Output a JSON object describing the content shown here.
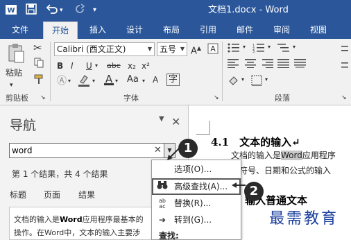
{
  "titlebar": {
    "title": "文档1.docx - Word",
    "quick_access": [
      "word-logo-icon",
      "save-icon",
      "undo-icon",
      "undo-dropdown-icon",
      "redo-icon",
      "customize-quick-access-icon"
    ]
  },
  "tabs": [
    "文件",
    "开始",
    "插入",
    "设计",
    "布局",
    "引用",
    "邮件",
    "审阅",
    "视图"
  ],
  "active_tab": "开始",
  "ribbon": {
    "clipboard": {
      "paste_label": "粘贴",
      "group_label": "剪贴板"
    },
    "font": {
      "font_name": "Calibri (西文正文)",
      "font_size": "五号",
      "buttons": [
        "B",
        "I",
        "U",
        "abc",
        "x₂",
        "x²"
      ],
      "group_label": "字体"
    },
    "paragraph": {
      "group_label": "段落"
    }
  },
  "nav_pane": {
    "title": "导航",
    "search_value": "word",
    "result_count": "第 1 个结果，共 4 个结果",
    "tabs": [
      "标题",
      "页面",
      "结果"
    ],
    "snippet_line1_prefix": "文档的输入是",
    "snippet_line1_bold": "Word",
    "snippet_line1_suffix": "应用程序最基本的",
    "snippet_line2": "操作。在Word中，文本的输入主要涉"
  },
  "menu": {
    "items": [
      {
        "label": "选项(O)...",
        "icon": ""
      },
      {
        "label": "高级查找(A)...",
        "icon": "binoculars-icon"
      },
      {
        "label": "替换(R)...",
        "icon": "replace-icon"
      },
      {
        "label": "转到(G)...",
        "icon": "arrow-right-icon"
      }
    ],
    "section_header": "查找:"
  },
  "callouts": [
    "1",
    "2"
  ],
  "document": {
    "heading1": "4.1　文本的输入↵",
    "para1_prefix": "文档的输入是",
    "para1_highlight": "Word",
    "para1_suffix": "应用程序",
    "para2": "殊符号、日期和公式的输入",
    "heading2": "输入普通文本",
    "watermark": "最需教育"
  },
  "colors": {
    "title_bar": "#2b579a",
    "ribbon_bg": "#f1f1f1",
    "nav_bg": "#f3f3f3",
    "watermark": "#1b3f9c"
  }
}
